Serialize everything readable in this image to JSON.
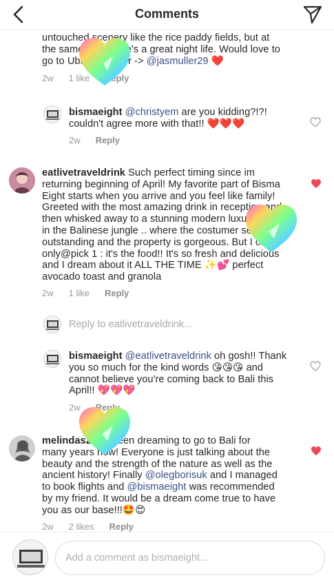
{
  "header": {
    "title": "Comments"
  },
  "comments": [
    {
      "id": "c0",
      "fragment_line1": "untouched scenery like the rice paddy fields, but at",
      "fragment_line2": "the same time there's a great night life. Would love to",
      "fragment_line3_a": "go to Ubud together -> ",
      "fragment_line3_mention": "@jasmuller29",
      "emoji": "❤️",
      "time": "2w",
      "likes": "1 like",
      "reply": "Reply"
    },
    {
      "id": "c1",
      "username": "bismaeight",
      "mention": "@christyem",
      "text1": " are you kidding?!?!",
      "text2": "couldn't agree more with that!! ",
      "emoji": "❤️❤️❤️",
      "time": "2w",
      "reply": "Reply"
    },
    {
      "id": "c2",
      "username": "eatlivetraveldrink",
      "lines": [
        " Such perfect timing since im",
        "returning beginning of April! My favorite part of Bisma",
        "Eight starts when you arrive and you feel like family!",
        "Greeted with the most amazing drink in reception and",
        "then whisked away to a stunning modern luxury room",
        "in the Balinese jungle .. where the costumer service is",
        "outstanding and the property is gorgeous. But I can",
        "only@pick 1 : it's the food!! It's so fresh and delicious",
        "and I dream about it ALL THE TIME ✨💕 perfect",
        "avocado toast and granola"
      ],
      "time": "2w",
      "likes": "1 like",
      "reply": "Reply"
    },
    {
      "id": "c3",
      "reply_prompt": "Reply to eatlivetraveldrink..."
    },
    {
      "id": "c4",
      "username": "bismaeight",
      "mention": "@eatlivetraveldrink",
      "text1": " oh gosh!! Thank",
      "text2": "you so much for the kind words 😘😘😘 and",
      "text3": "cannot believe you're coming back to Bali this",
      "text4": "April!! 💖💖💖",
      "time": "2w",
      "reply": "Reply"
    },
    {
      "id": "c5",
      "username": "melindasz",
      "text1": " I've been dreaming to go to Bali for",
      "text2": "many years now! Everyone is just talking about the",
      "text3": "beauty and the strength of the nature as well as the",
      "text4a": "ancient history! Finally ",
      "mention1": "@olegborisuk",
      "text4b": " and I managed",
      "text5a": "to book flights and ",
      "mention2": "@bismaeight",
      "text5b": " was recommended",
      "text6": "by my friend. It would be a dream come true to have",
      "text7": "you as our base!!!🤩😍",
      "time": "2w",
      "likes": "2 likes",
      "reply": "Reply"
    }
  ],
  "composer": {
    "placeholder": "Add a comment as bismaeight..."
  },
  "colors": {
    "heart_red": "#ed4956",
    "mention": "#385185",
    "meta": "#999999"
  }
}
